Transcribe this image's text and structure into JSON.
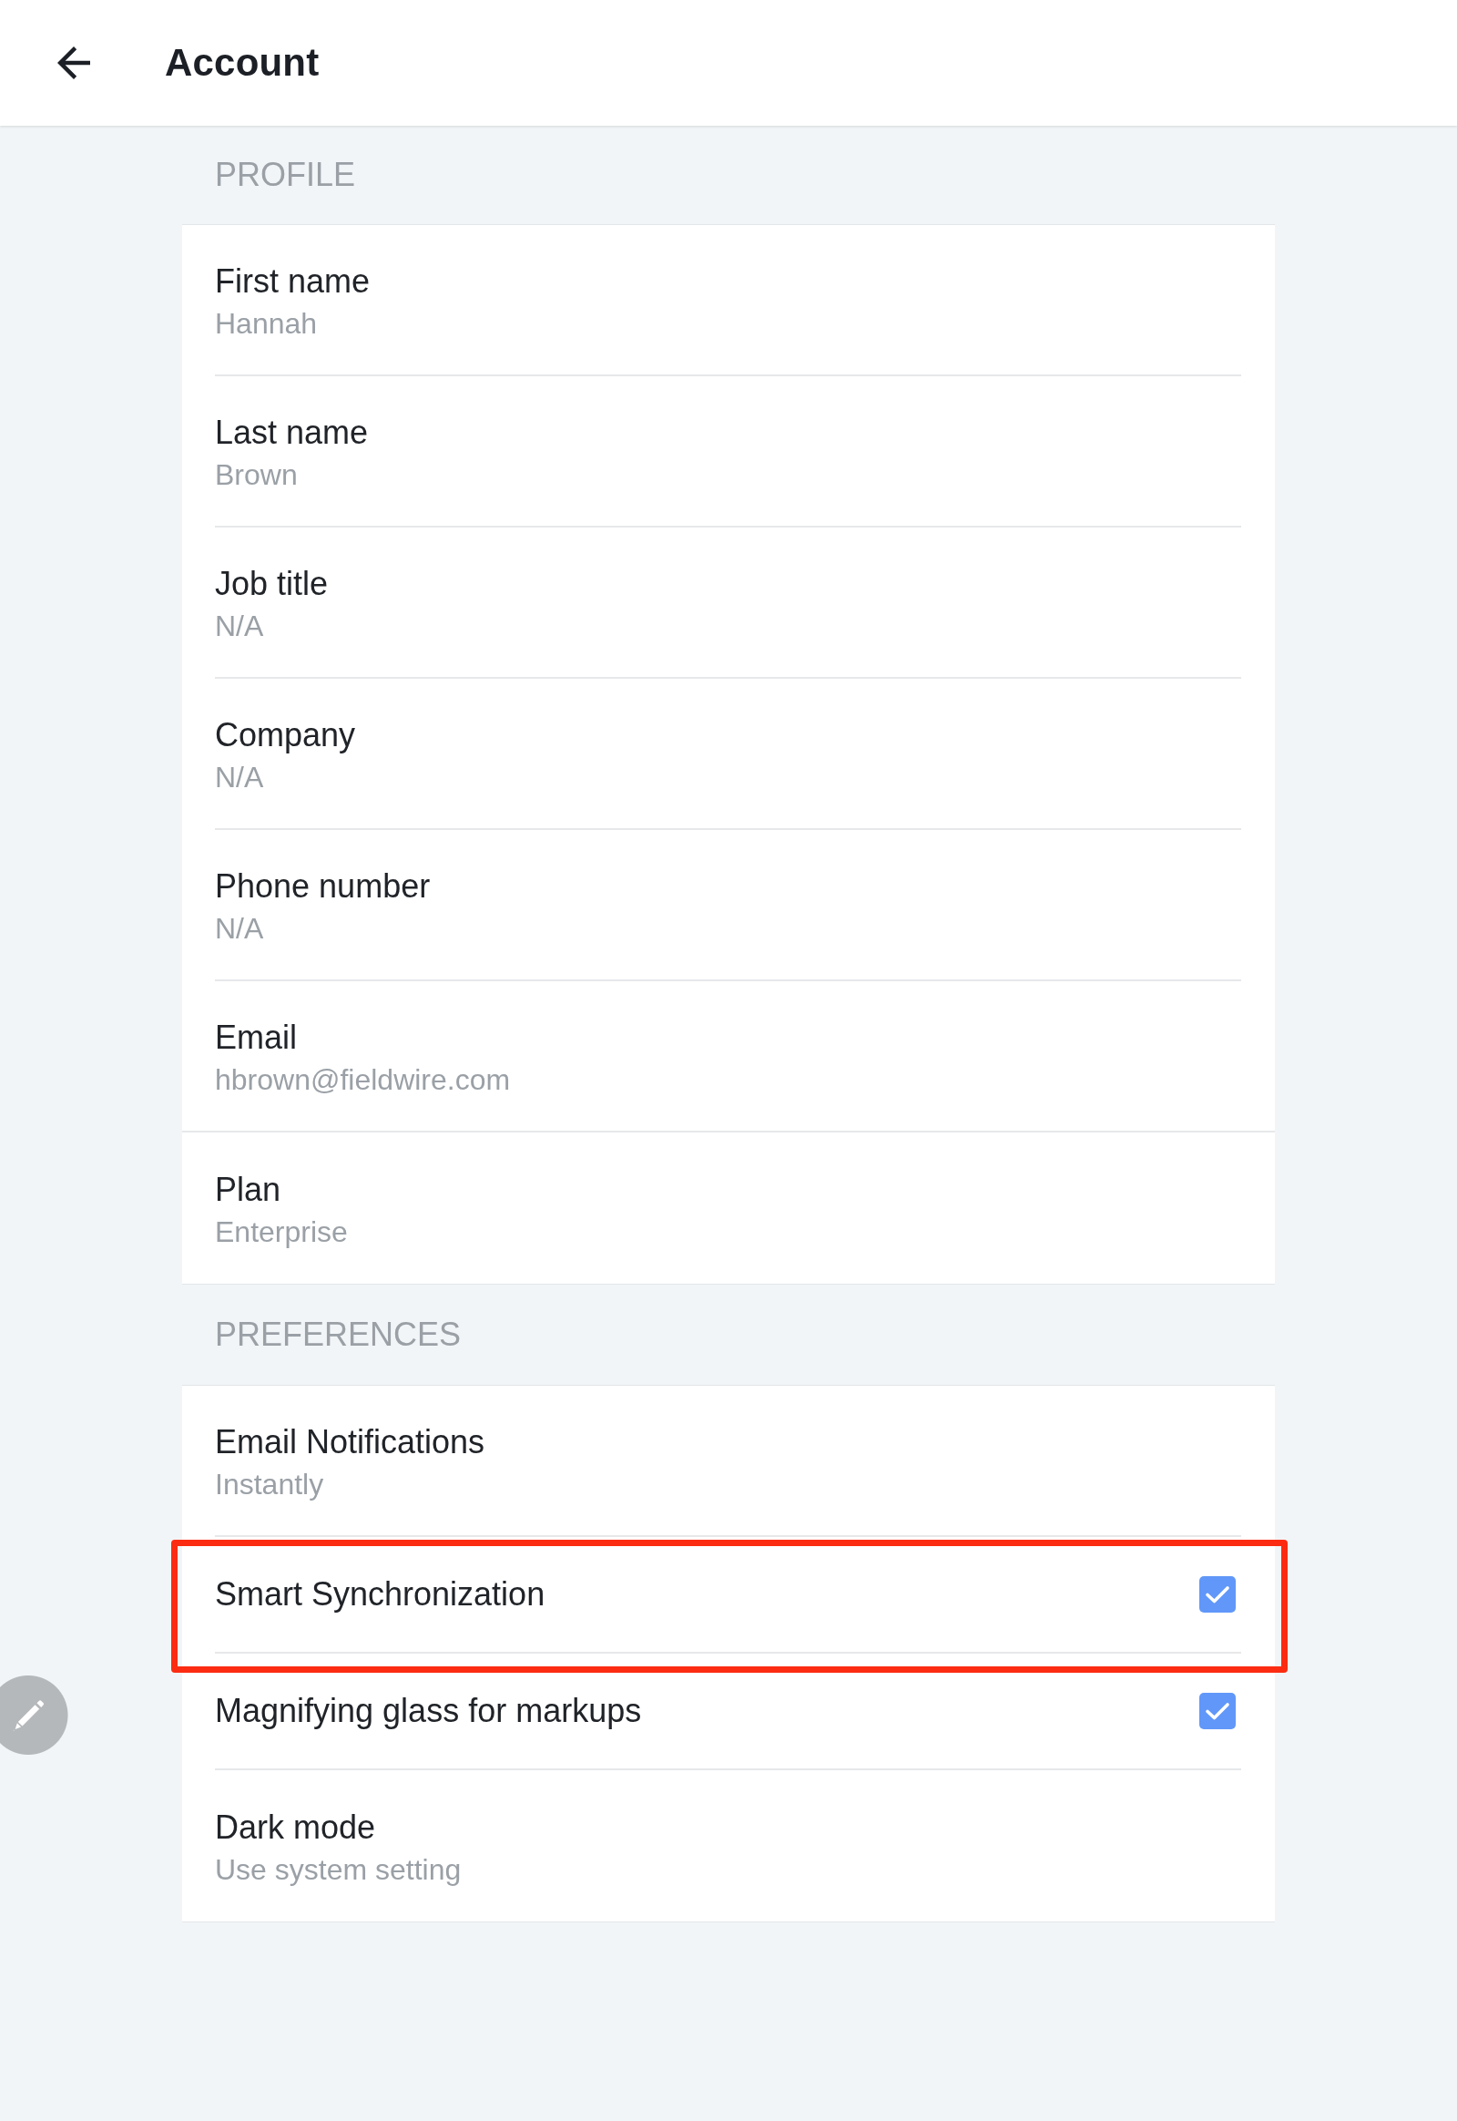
{
  "header": {
    "title": "Account"
  },
  "sections": [
    {
      "title": "PROFILE",
      "items": [
        {
          "kind": "field",
          "label": "First name",
          "value": "Hannah",
          "highlighted": false
        },
        {
          "kind": "field",
          "label": "Last name",
          "value": "Brown",
          "highlighted": false
        },
        {
          "kind": "field",
          "label": "Job title",
          "value": "N/A",
          "highlighted": false
        },
        {
          "kind": "field",
          "label": "Company",
          "value": "N/A",
          "highlighted": false
        },
        {
          "kind": "field",
          "label": "Phone number",
          "value": "N/A",
          "highlighted": false
        },
        {
          "kind": "field",
          "label": "Email",
          "value": "hbrown@fieldwire.com",
          "highlighted": false
        },
        {
          "kind": "field",
          "label": "Plan",
          "value": "Enterprise",
          "highlighted": false
        }
      ]
    },
    {
      "title": "PREFERENCES",
      "items": [
        {
          "kind": "field",
          "label": "Email Notifications",
          "value": "Instantly",
          "highlighted": false
        },
        {
          "kind": "checkbox",
          "label": "Smart Synchronization",
          "checked": true,
          "highlighted": true
        },
        {
          "kind": "checkbox",
          "label": "Magnifying glass for markups",
          "checked": true,
          "highlighted": false
        },
        {
          "kind": "field",
          "label": "Dark mode",
          "value": "Use system setting",
          "highlighted": false
        }
      ]
    }
  ]
}
